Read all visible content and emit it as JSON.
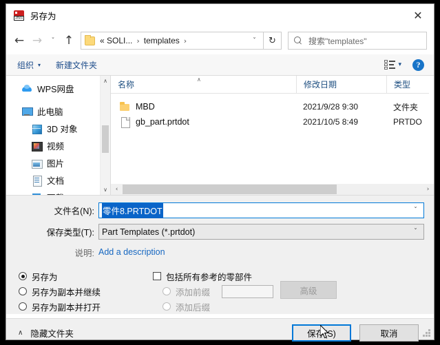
{
  "window": {
    "title": "另存为",
    "app_icon": "solidworks-2021-icon",
    "close_label": "✕"
  },
  "nav": {
    "back_icon": "←",
    "forward_icon": "→",
    "recent_icon": "ˇ",
    "up_icon": "↑",
    "breadcrumb": {
      "folder_icon": "folder-icon",
      "items": [
        "« SOLI...",
        "templates"
      ],
      "separator": "›",
      "dropdown_icon": "ˇ"
    },
    "refresh_icon": "↻",
    "search": {
      "icon": "search-icon",
      "placeholder": "搜索\"templates\""
    }
  },
  "command_bar": {
    "organize_label": "组织",
    "organize_caret": "▾",
    "new_folder_label": "新建文件夹",
    "view_caret": "▾",
    "help_label": "?"
  },
  "sidebar": {
    "items": [
      {
        "label": "WPS网盘",
        "icon": "cloud-icon",
        "indent": false
      },
      {
        "label": "此电脑",
        "icon": "computer-icon",
        "indent": false
      },
      {
        "label": "3D 对象",
        "icon": "3d-objects-icon",
        "indent": true
      },
      {
        "label": "视频",
        "icon": "videos-icon",
        "indent": true
      },
      {
        "label": "图片",
        "icon": "pictures-icon",
        "indent": true
      },
      {
        "label": "文档",
        "icon": "documents-icon",
        "indent": true
      },
      {
        "label": "下载",
        "icon": "downloads-icon",
        "indent": true
      }
    ],
    "scroll_up_icon": "∧",
    "scroll_down_icon": "∨"
  },
  "file_list": {
    "columns": [
      "名称",
      "修改日期",
      "类型"
    ],
    "sort_indicator": "∧",
    "rows": [
      {
        "name": "MBD",
        "icon": "folder-icon",
        "date": "2021/9/28 9:30",
        "type": "文件夹"
      },
      {
        "name": "gb_part.prtdot",
        "icon": "file-icon",
        "date": "2021/10/5 8:49",
        "type": "PRTDO"
      }
    ],
    "hscroll_left_icon": "‹",
    "hscroll_right_icon": "›"
  },
  "form": {
    "filename_label": "文件名(N):",
    "filename_value": "零件8.PRTDOT",
    "filename_caret": "ˇ",
    "filetype_label": "保存类型(T):",
    "filetype_value": "Part Templates (*.prtdot)",
    "filetype_caret": "ˇ",
    "description_label": "说明:",
    "description_link": "Add a description"
  },
  "options": {
    "radios": [
      {
        "label": "另存为",
        "checked": true
      },
      {
        "label": "另存为副本并继续",
        "checked": false
      },
      {
        "label": "另存为副本并打开",
        "checked": false
      }
    ],
    "include_refs": {
      "label": "包括所有参考的零部件",
      "checked": false
    },
    "prefix": {
      "label": "添加前缀",
      "checked": false,
      "disabled": true
    },
    "suffix": {
      "label": "添加后缀",
      "checked": false,
      "disabled": true
    },
    "affix_value": "",
    "advanced_label": "高级"
  },
  "footer": {
    "hide_folders_caret": "∧",
    "hide_folders_label": "隐藏文件夹",
    "save_label": "保存(S)",
    "cancel_label": "取消"
  },
  "colors": {
    "accent": "#0078d7",
    "selection": "#0a64c8",
    "link": "#1667c1",
    "command_link": "#1e4d8b",
    "column_header": "#1d4e80"
  }
}
